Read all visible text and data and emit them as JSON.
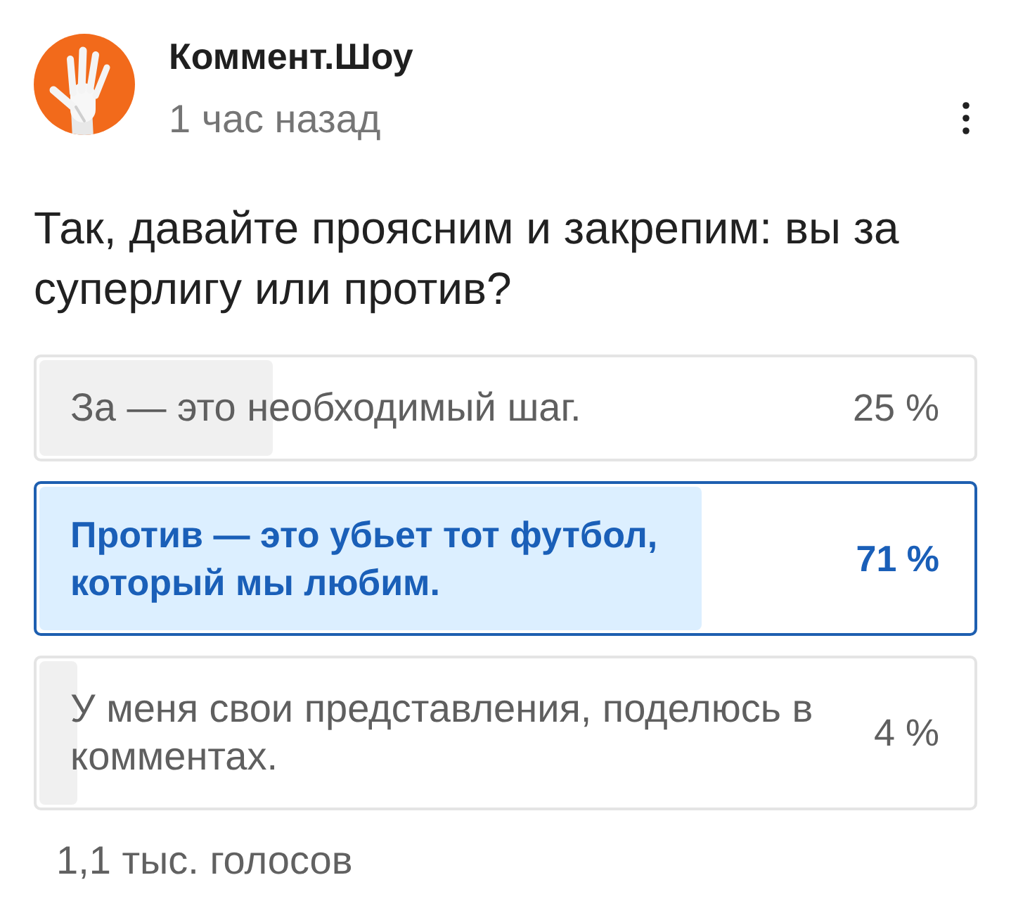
{
  "post": {
    "author": "Коммент.Шоу",
    "time": "1 час назад"
  },
  "question": "Так, давайте проясним и закрепим: вы за суперлигу или против?",
  "options": [
    {
      "text": "За — это необходимый шаг.",
      "percent": "25 %",
      "level": 0.25,
      "selected": false
    },
    {
      "text": "Против — это убьет тот футбол, который мы любим.",
      "percent": "71 %",
      "level": 0.71,
      "selected": true
    },
    {
      "text": "У меня свои представления, поделюсь в комментах.",
      "percent": "4 %",
      "level": 0.04,
      "selected": false
    }
  ],
  "votes": "1,1 тыс. голосов"
}
